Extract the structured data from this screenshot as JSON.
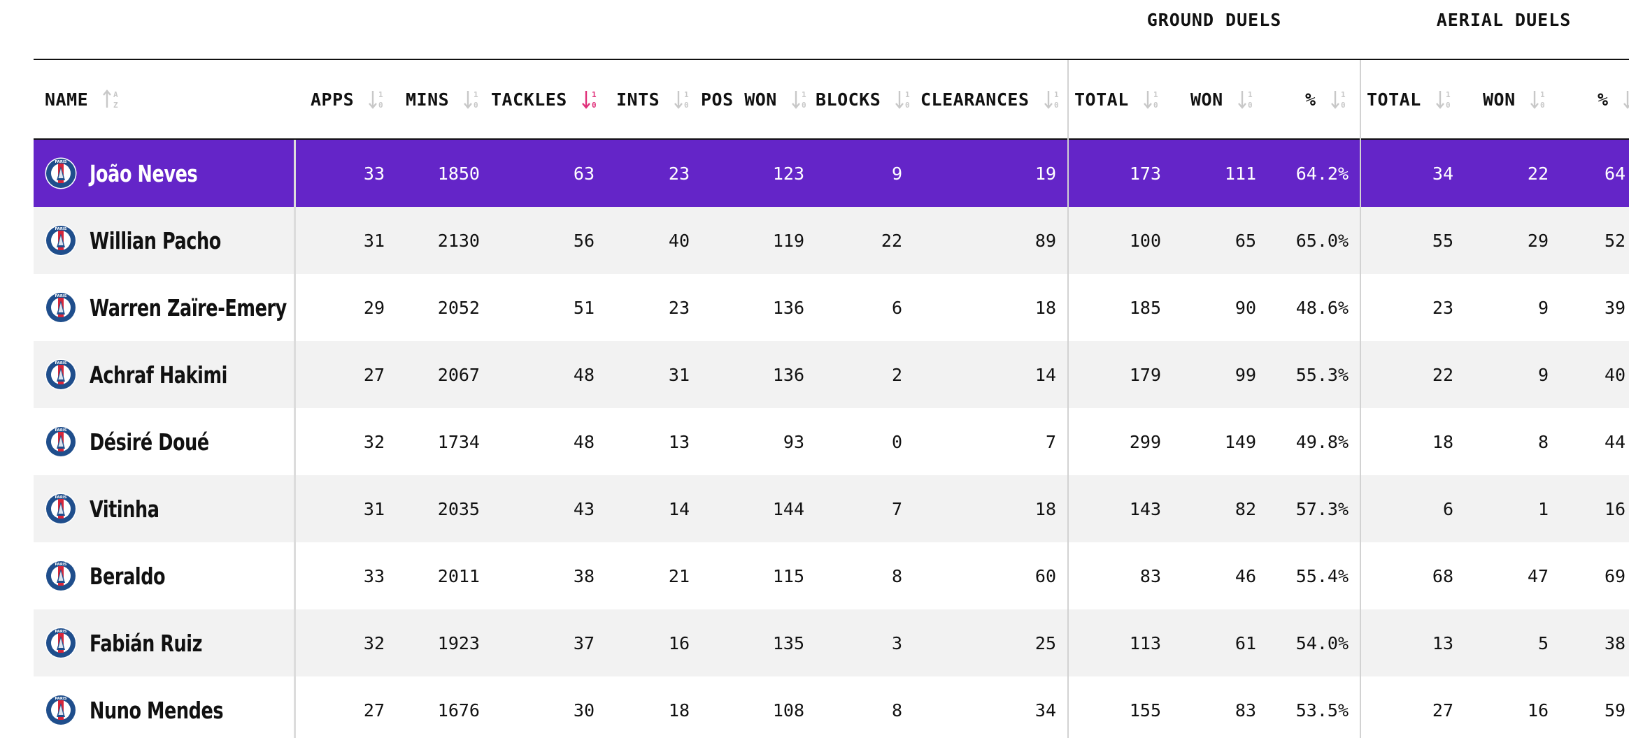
{
  "group_headers": {
    "ground": "GROUND DUELS",
    "aerial": "AERIAL DUELS"
  },
  "columns": {
    "name": "NAME",
    "apps": "APPS",
    "mins": "MINS",
    "tackles": "TACKLES",
    "ints": "INTS",
    "pos_won": "POS WON",
    "blocks": "BLOCKS",
    "clearances": "CLEARANCES",
    "gd_total": "TOTAL",
    "gd_won": "WON",
    "gd_pct": "%",
    "ad_total": "TOTAL",
    "ad_won": "WON",
    "ad_pct": "%"
  },
  "sorted_column": "tackles",
  "colors": {
    "highlight_row": "#6425c8",
    "active_sort": "#e0307a",
    "crest_blue": "#1f4e8c",
    "crest_red": "#d8263a"
  },
  "crest_icon": "psg-crest-icon",
  "rows": [
    {
      "name": "João Neves",
      "apps": "33",
      "mins": "1850",
      "tackles": "63",
      "ints": "23",
      "pos_won": "123",
      "blocks": "9",
      "clearances": "19",
      "gd_total": "173",
      "gd_won": "111",
      "gd_pct": "64.2%",
      "ad_total": "34",
      "ad_won": "22",
      "ad_pct": "64.",
      "highlight": true
    },
    {
      "name": "Willian Pacho",
      "apps": "31",
      "mins": "2130",
      "tackles": "56",
      "ints": "40",
      "pos_won": "119",
      "blocks": "22",
      "clearances": "89",
      "gd_total": "100",
      "gd_won": "65",
      "gd_pct": "65.0%",
      "ad_total": "55",
      "ad_won": "29",
      "ad_pct": "52."
    },
    {
      "name": "Warren Zaïre-Emery",
      "apps": "29",
      "mins": "2052",
      "tackles": "51",
      "ints": "23",
      "pos_won": "136",
      "blocks": "6",
      "clearances": "18",
      "gd_total": "185",
      "gd_won": "90",
      "gd_pct": "48.6%",
      "ad_total": "23",
      "ad_won": "9",
      "ad_pct": "39."
    },
    {
      "name": "Achraf Hakimi",
      "apps": "27",
      "mins": "2067",
      "tackles": "48",
      "ints": "31",
      "pos_won": "136",
      "blocks": "2",
      "clearances": "14",
      "gd_total": "179",
      "gd_won": "99",
      "gd_pct": "55.3%",
      "ad_total": "22",
      "ad_won": "9",
      "ad_pct": "40."
    },
    {
      "name": "Désiré Doué",
      "apps": "32",
      "mins": "1734",
      "tackles": "48",
      "ints": "13",
      "pos_won": "93",
      "blocks": "0",
      "clearances": "7",
      "gd_total": "299",
      "gd_won": "149",
      "gd_pct": "49.8%",
      "ad_total": "18",
      "ad_won": "8",
      "ad_pct": "44."
    },
    {
      "name": "Vitinha",
      "apps": "31",
      "mins": "2035",
      "tackles": "43",
      "ints": "14",
      "pos_won": "144",
      "blocks": "7",
      "clearances": "18",
      "gd_total": "143",
      "gd_won": "82",
      "gd_pct": "57.3%",
      "ad_total": "6",
      "ad_won": "1",
      "ad_pct": "16."
    },
    {
      "name": "Beraldo",
      "apps": "33",
      "mins": "2011",
      "tackles": "38",
      "ints": "21",
      "pos_won": "115",
      "blocks": "8",
      "clearances": "60",
      "gd_total": "83",
      "gd_won": "46",
      "gd_pct": "55.4%",
      "ad_total": "68",
      "ad_won": "47",
      "ad_pct": "69."
    },
    {
      "name": "Fabián Ruiz",
      "apps": "32",
      "mins": "1923",
      "tackles": "37",
      "ints": "16",
      "pos_won": "135",
      "blocks": "3",
      "clearances": "25",
      "gd_total": "113",
      "gd_won": "61",
      "gd_pct": "54.0%",
      "ad_total": "13",
      "ad_won": "5",
      "ad_pct": "38."
    },
    {
      "name": "Nuno Mendes",
      "apps": "27",
      "mins": "1676",
      "tackles": "30",
      "ints": "18",
      "pos_won": "108",
      "blocks": "8",
      "clearances": "34",
      "gd_total": "155",
      "gd_won": "83",
      "gd_pct": "53.5%",
      "ad_total": "27",
      "ad_won": "16",
      "ad_pct": "59."
    }
  ]
}
